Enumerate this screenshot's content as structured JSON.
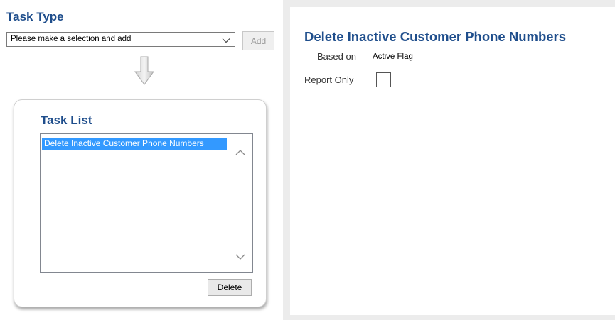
{
  "task_type": {
    "title": "Task Type",
    "select_value": "Please make a selection and add",
    "add_label": "Add"
  },
  "task_list": {
    "title": "Task List",
    "items": [
      "Delete Inactive Customer Phone Numbers"
    ],
    "delete_label": "Delete"
  },
  "detail": {
    "title": "Delete Inactive Customer Phone Numbers",
    "based_on_label": "Based on",
    "based_on_value": "Active Flag",
    "report_only_label": "Report Only",
    "report_only_checked": false
  },
  "colors": {
    "heading": "#1f4e8c",
    "selection": "#3399ff"
  },
  "icons": [
    "chevron-down-icon",
    "down-arrow-icon",
    "scroll-up-icon",
    "scroll-down-icon"
  ]
}
